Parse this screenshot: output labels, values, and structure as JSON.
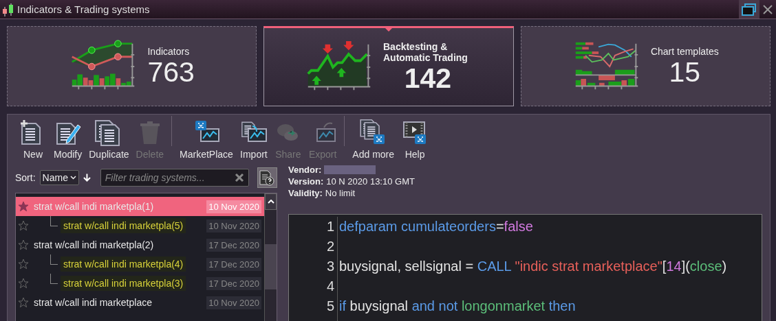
{
  "window": {
    "title": "Indicators & Trading systems"
  },
  "cards": [
    {
      "kind": "indicators",
      "title": "Indicators",
      "count": "763",
      "selected": false
    },
    {
      "kind": "backtesting",
      "title": "Backtesting & Automatic Trading",
      "count": "142",
      "selected": true
    },
    {
      "kind": "templates",
      "title": "Chart templates",
      "count": "15",
      "selected": false
    }
  ],
  "toolbar": [
    {
      "kind": "new",
      "label": "New",
      "disabled": false
    },
    {
      "kind": "modify",
      "label": "Modify",
      "disabled": false
    },
    {
      "kind": "duplicate",
      "label": "Duplicate",
      "disabled": false
    },
    {
      "kind": "delete",
      "label": "Delete",
      "disabled": true
    },
    {
      "kind": "marketplace",
      "label": "MarketPlace",
      "disabled": false
    },
    {
      "kind": "import",
      "label": "Import",
      "disabled": false
    },
    {
      "kind": "share",
      "label": "Share",
      "disabled": true
    },
    {
      "kind": "export",
      "label": "Export",
      "disabled": true
    },
    {
      "kind": "addmore",
      "label": "Add more",
      "disabled": false
    },
    {
      "kind": "help",
      "label": "Help",
      "disabled": false
    }
  ],
  "sort": {
    "label": "Sort:",
    "value": "Name"
  },
  "filter": {
    "placeholder": "Filter trading systems..."
  },
  "systems": [
    {
      "name": "strat w/call indi marketpla(1)",
      "date": "10 Nov 2020",
      "selected": true,
      "children": [
        {
          "name": "strat w/call indi marketpla(5)",
          "date": "10 Nov 2020",
          "selected": false
        }
      ]
    },
    {
      "name": "strat w/call indi marketpla(2)",
      "date": "17 Dec 2020",
      "selected": false,
      "children": [
        {
          "name": "strat w/call indi marketpla(4)",
          "date": "17 Dec 2020",
          "selected": false
        },
        {
          "name": "strat w/call indi marketpla(3)",
          "date": "17 Dec 2020",
          "selected": false
        }
      ]
    },
    {
      "name": "strat w/call indi marketplace",
      "date": "10 Nov 2020",
      "selected": false
    }
  ],
  "details": [
    {
      "label": "Vendor:",
      "value_hidden": true
    },
    {
      "label": "Version:",
      "value": "10 N 2020 13:10 GMT"
    },
    {
      "label": "Validity:",
      "value": "No limit"
    }
  ],
  "code": [
    {
      "number": "1",
      "tokens": [
        {
          "kind": "keyword",
          "text": "defparam cumulateorders"
        },
        {
          "kind": "plain",
          "text": "="
        },
        {
          "kind": "constant",
          "text": "false"
        }
      ]
    },
    {
      "number": "2"
    },
    {
      "number": "3",
      "tokens": [
        {
          "kind": "plain",
          "text": "buysignal, sellsignal = "
        },
        {
          "kind": "keyword",
          "text": "CALL "
        },
        {
          "kind": "string",
          "text": "\"indic strat marketplace\""
        },
        {
          "kind": "plain",
          "text": "["
        },
        {
          "kind": "constant",
          "text": "14"
        },
        {
          "kind": "plain",
          "text": "]("
        },
        {
          "kind": "function",
          "text": "close"
        },
        {
          "kind": "plain",
          "text": ")"
        }
      ]
    },
    {
      "number": "4"
    },
    {
      "number": "5",
      "tokens": [
        {
          "kind": "keyword",
          "text": "if "
        },
        {
          "kind": "plain",
          "text": "buysignal "
        },
        {
          "kind": "keyword",
          "text": "and not "
        },
        {
          "kind": "function",
          "text": "longonmarket "
        },
        {
          "kind": "keyword",
          "text": "then"
        }
      ]
    }
  ]
}
